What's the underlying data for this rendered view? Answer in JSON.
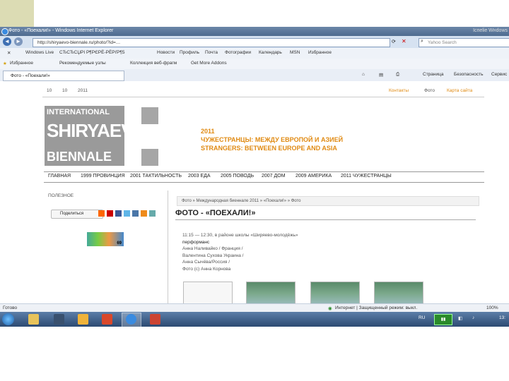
{
  "browser": {
    "title": "Фото - «Поехали!» - Windows Internet Explorer",
    "title_right": "Іспеlie Wнdows",
    "url": "http://shiryaevo-biennale.ru/photo/?id=…",
    "search_placeholder": "Yahoo Search",
    "links_bar": [
      "Windows Live",
      "СЂСЂСЏРІ Р¶РЄРЁ-РЁРѓР¶5",
      "Новости",
      "Профиль",
      "Почта",
      "Фотографии",
      "Календарь",
      "MSN",
      "Избранное"
    ],
    "favorites_label": "Избранное",
    "favorites_items": [
      "Рекомендуемые узлы",
      "Коллекция веб-фрагм",
      "Get More Addons"
    ],
    "tab_title": "Фото - «Поехали!»",
    "tools": [
      "Страница",
      "Безопасность",
      "Сервис"
    ]
  },
  "site": {
    "date": [
      "10",
      "10",
      "2011"
    ],
    "top_links": [
      "Контакты",
      "Фото",
      "Карта сайта"
    ],
    "logo": [
      "INTERNATIONAL",
      "SHIRYAEVO",
      "BIENNALE"
    ],
    "headline": [
      "2011",
      "ЧУЖЕСТРАНЦЫ: МЕЖДУ ЕВРОПОЙ И АЗИЕЙ",
      "STRANGERS: BETWEEN EUROPE AND ASIA"
    ],
    "menu": [
      "ГЛАВНАЯ",
      "1999 ПРОВИНЦИЯ",
      "2001 ТАКТИЛЬНОСТЬ",
      "2003 ЕДА",
      "2005 ПОВОДЬ",
      "2007 ДОМ",
      "2009 АМЕРИКА",
      "2011 ЧУЖЕСТРАНЦЫ"
    ],
    "sidebar_heading": "ПОЛЕЗНОЕ",
    "share_label": "Поделиться",
    "counter_value": "69",
    "breadcrumb": "Фото » Международная биеннале 2011 » «Поехали!» » Фото",
    "page_title": "ФОТО - «ПОЕХАЛИ!»",
    "info_lines": [
      "11:15 — 12:30, в районе школы «Ширяево-молодёжь»",
      "перформанс",
      "Анна Наливайко / Франция /",
      "Валентина Сухова Украина /",
      "Анна Сычёва/Россия /",
      "Фото (c) Анна Корнова"
    ]
  },
  "status": {
    "left": "Готово",
    "zone": "Интернет | Защищенный режим: выкл.",
    "zoom": "100%"
  },
  "taskbar": {
    "lang": "RU",
    "clock": "13:"
  },
  "colors": {
    "accent_orange": "#e08a12",
    "logo_gray": "#9a9a9a",
    "corner_block": "#dcdcb4"
  }
}
